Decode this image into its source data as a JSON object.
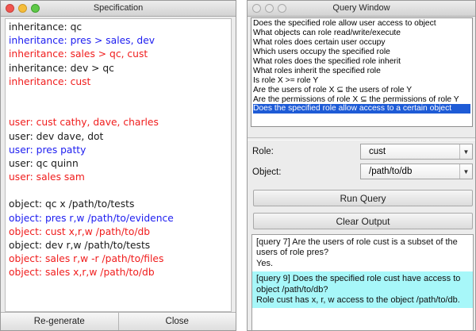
{
  "spec_window": {
    "title": "Specification",
    "lines": [
      {
        "text": "inheritance: qc",
        "color": "#1a1a1a"
      },
      {
        "text": "inheritance: pres > sales, dev",
        "color": "#1c1cf0"
      },
      {
        "text": "inheritance: sales > qc, cust",
        "color": "#f01c1c"
      },
      {
        "text": "inheritance: dev > qc",
        "color": "#1a1a1a"
      },
      {
        "text": "inheritance: cust",
        "color": "#f01c1c"
      },
      {
        "text": "",
        "color": ""
      },
      {
        "text": "",
        "color": ""
      },
      {
        "text": "user: cust cathy, dave, charles",
        "color": "#f01c1c"
      },
      {
        "text": "user: dev dave, dot",
        "color": "#1a1a1a"
      },
      {
        "text": "user: pres patty",
        "color": "#1c1cf0"
      },
      {
        "text": "user: qc quinn",
        "color": "#1a1a1a"
      },
      {
        "text": "user: sales sam",
        "color": "#f01c1c"
      },
      {
        "text": "",
        "color": ""
      },
      {
        "text": "object: qc x /path/to/tests",
        "color": "#1a1a1a"
      },
      {
        "text": "object: pres r,w /path/to/evidence",
        "color": "#1c1cf0"
      },
      {
        "text": "object: cust x,r,w /path/to/db",
        "color": "#f01c1c"
      },
      {
        "text": "object: dev r,w /path/to/tests",
        "color": "#1a1a1a"
      },
      {
        "text": "object: sales r,w -r /path/to/files",
        "color": "#f01c1c"
      },
      {
        "text": "object: sales x,r,w /path/to/db",
        "color": "#f01c1c"
      }
    ],
    "regenerate_label": "Re-generate",
    "close_label": "Close"
  },
  "query_window": {
    "title": "Query Window",
    "queries": [
      "Does the specified role allow user access to object",
      "What objects can role read/write/execute",
      "What roles does certain user occupy",
      "Which users occupy the specified role",
      "What roles does the specified role inherit",
      "What roles inherit the specified role",
      "Is role X >= role Y",
      "Are the users of role X ⊆ the users of role Y",
      "Are the permissions of role X ⊆ the permissions of role Y",
      "Does the specified role allow access to a certain object"
    ],
    "selected_query_index": 9,
    "role_label": "Role:",
    "role_value": "cust",
    "object_label": "Object:",
    "object_value": "/path/to/db",
    "run_query_label": "Run Query",
    "clear_output_label": "Clear Output",
    "output": [
      {
        "text": "[query 7] Are the users of role cust is a subset of the users of role pres?\nYes.",
        "highlight": false
      },
      {
        "text": "[query 9] Does the specified role cust have access to object /path/to/db?\nRole cust has x, r, w access to the object /path/to/db.",
        "highlight": true
      }
    ],
    "highlight_color": "#a7f7f9"
  }
}
